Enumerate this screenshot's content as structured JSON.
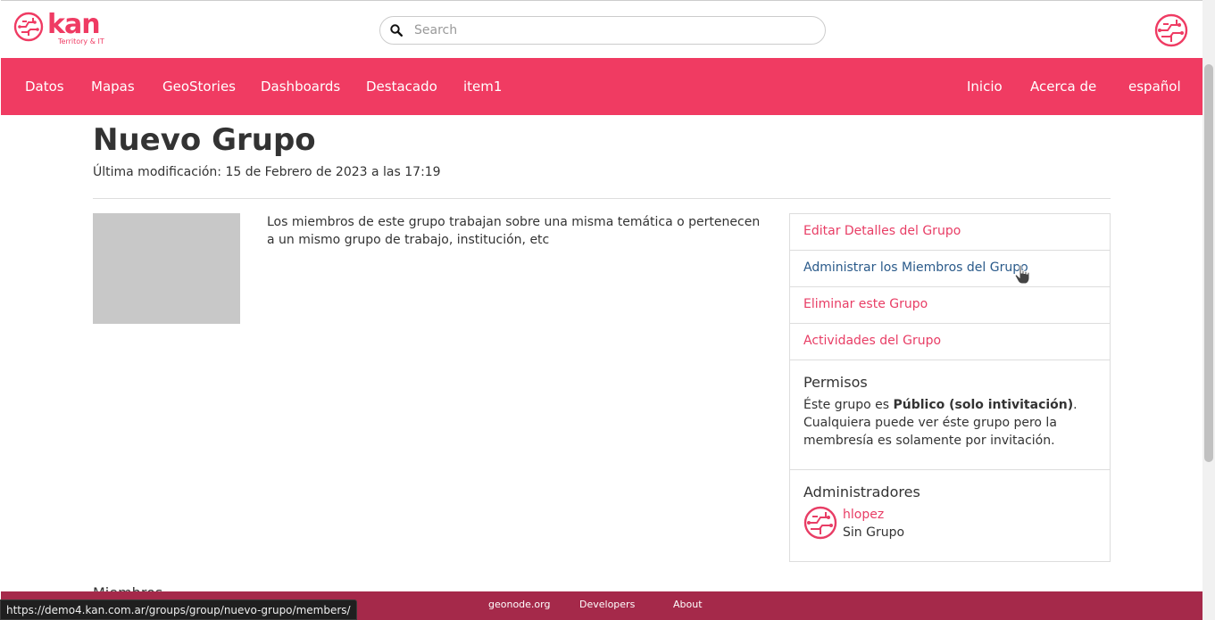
{
  "header": {
    "logo_word": "kan",
    "logo_tagline": "Territory & IT",
    "search_placeholder": "Search"
  },
  "nav": {
    "left": [
      "Datos",
      "Mapas",
      "GeoStories",
      "Dashboards",
      "Destacado",
      "item1"
    ],
    "right": [
      "Inicio",
      "Acerca de",
      "español"
    ]
  },
  "page": {
    "title": "Nuevo Grupo",
    "modified": "Última modificación: 15 de Febrero de 2023 a las 17:19",
    "description": "Los miembros de este grupo trabajan sobre una misma temática o pertenecen a un mismo grupo de trabajo, institución, etc",
    "members_heading": "Miembros"
  },
  "sidebar": {
    "links": [
      "Editar Detalles del Grupo",
      "Administrar los Miembros del Grupo",
      "Eliminar este Grupo",
      "Actividades del Grupo"
    ],
    "permissions": {
      "heading": "Permisos",
      "text_before": "Éste grupo es ",
      "text_bold": "Público (solo intivitación)",
      "text_after": ". Cualquiera puede ver éste grupo pero la membresía es solamente por invitación."
    },
    "admins": {
      "heading": "Administradores",
      "name": "hlopez",
      "group": "Sin Grupo"
    }
  },
  "footer": {
    "links": [
      "geonode.org",
      "Developers",
      "About"
    ]
  },
  "status_bar": {
    "url": "https://demo4.kan.com.ar/groups/group/nuevo-grupo/members/"
  },
  "colors": {
    "brand": "#f03b62",
    "footer": "#a5294a",
    "link": "#e83d65",
    "link_hover": "#2a5a8a"
  }
}
